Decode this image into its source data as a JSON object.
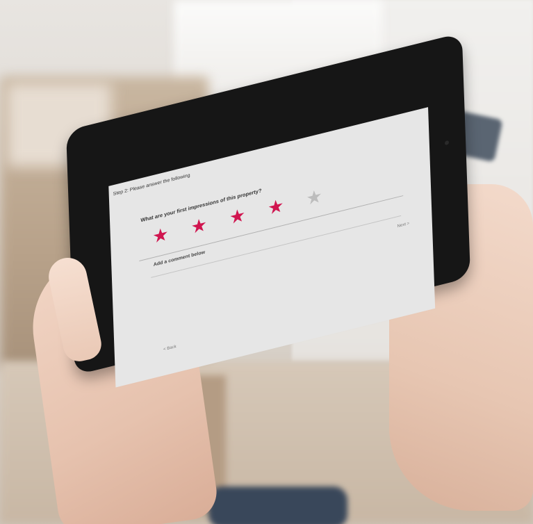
{
  "survey": {
    "step_title": "Step 2: Please answer the following",
    "question": "What are your first impressions of this property?",
    "rating": {
      "value": 4,
      "max": 5
    },
    "comment_placeholder": "Add a comment below",
    "next_label": "Next >",
    "back_label": "< Back"
  },
  "colors": {
    "star_active": "#d0154f",
    "star_inactive": "#bdbdbd",
    "screen_background": "#e6e6e6",
    "tablet_bezel": "#161616"
  }
}
